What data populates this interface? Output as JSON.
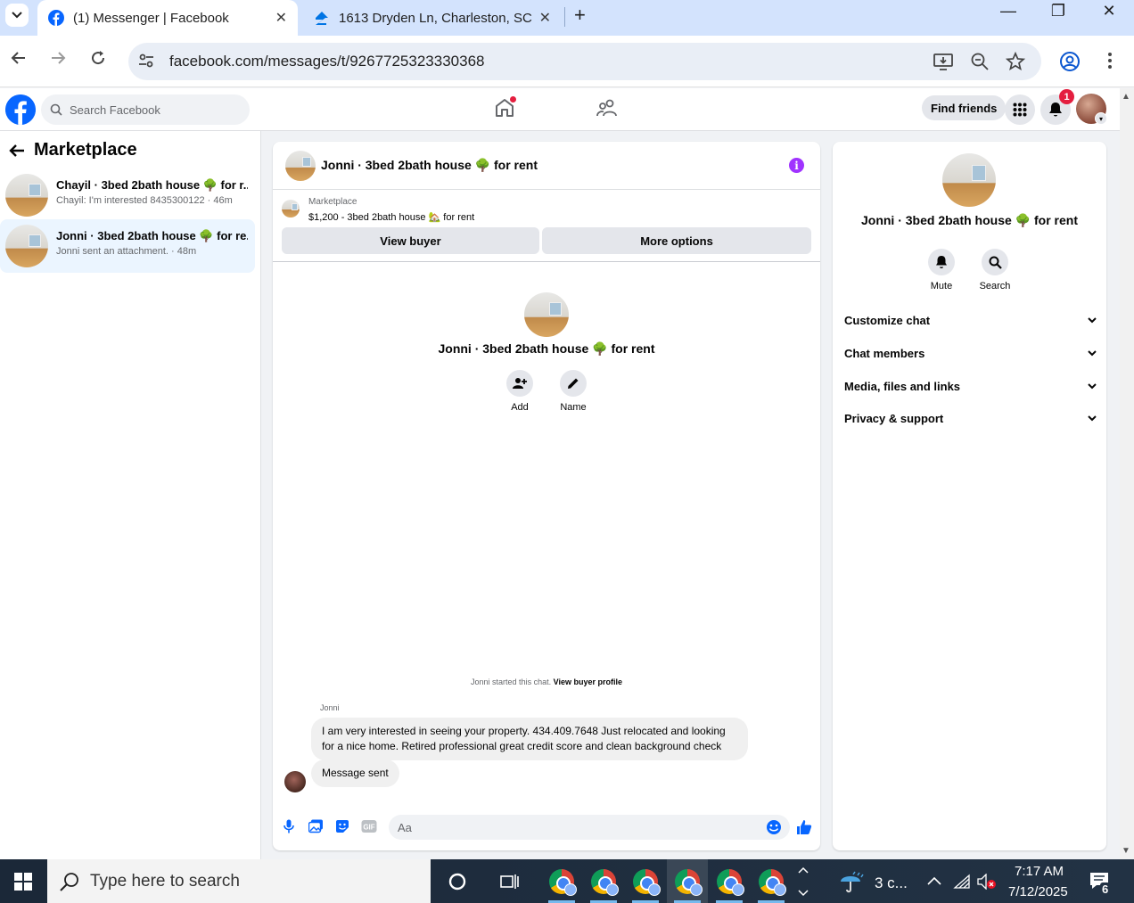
{
  "browser": {
    "tabs": [
      {
        "title": "(1) Messenger | Facebook",
        "active": true
      },
      {
        "title": "1613 Dryden Ln, Charleston, SC",
        "active": false
      }
    ],
    "url": "facebook.com/messages/t/9267725323330368"
  },
  "fb_header": {
    "search_placeholder": "Search Facebook",
    "find_friends": "Find friends",
    "notification_count": "1"
  },
  "sidebar": {
    "title": "Marketplace",
    "chats": [
      {
        "name": "Chayil · 3bed 2bath house 🌳 for r...",
        "preview": "Chayil: I'm interested 8435300122 · 46m"
      },
      {
        "name": "Jonni · 3bed 2bath house 🌳 for re...",
        "preview": "Jonni sent an attachment. · 48m"
      }
    ]
  },
  "conversation": {
    "title": "Jonni · 3bed 2bath house 🌳 for rent",
    "listing_label": "Marketplace",
    "listing_text": "$1,200 - 3bed 2bath house 🏡 for rent",
    "view_buyer": "View buyer",
    "more_options": "More options",
    "intro_name": "Jonni · 3bed 2bath house 🌳 for rent",
    "add_label": "Add",
    "name_label": "Name",
    "started_text": "Jonni started this chat.",
    "view_buyer_profile": "View buyer profile",
    "sender": "Jonni",
    "message": "I am very interested in seeing your property. 434.409.7648 Just relocated and looking for a nice home. Retired professional great credit score and clean background check",
    "reply": "Message sent",
    "composer_placeholder": "Aa"
  },
  "info_panel": {
    "name": "Jonni · 3bed 2bath house 🌳 for rent",
    "mute": "Mute",
    "search": "Search",
    "sections": [
      "Customize chat",
      "Chat members",
      "Media, files and links",
      "Privacy & support"
    ]
  },
  "taskbar": {
    "search_placeholder": "Type here to search",
    "weather": "3 c...",
    "time": "7:17 AM",
    "date": "7/12/2025",
    "notification_count": "6"
  },
  "colors": {
    "facebook_blue": "#0866ff",
    "messenger_purple": "#a033ff",
    "notification_red": "#e41e3f",
    "selected_chat": "#ebf5ff"
  }
}
